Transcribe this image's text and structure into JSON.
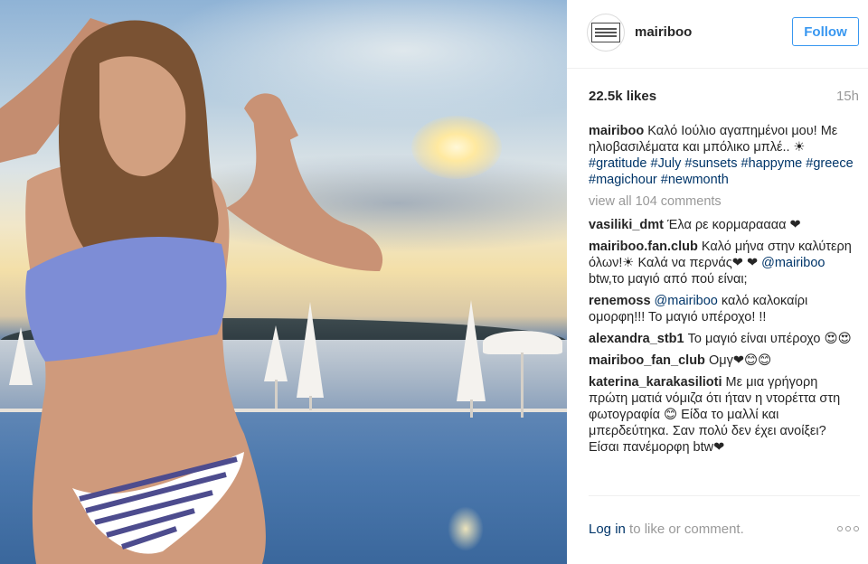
{
  "post": {
    "username": "mairiboo",
    "follow_label": "Follow",
    "likes": "22.5k likes",
    "time": "15h",
    "caption_user": "mairiboo",
    "caption_text": "Καλό Ιούλιο αγαπημένοι μου! Με ηλιοβασιλέματα και μπόλικο μπλέ.. ☀ ",
    "caption_tags": [
      "#gratitude",
      "#July",
      "#sunsets",
      "#happyme",
      "#greece",
      "#magichour",
      "#newmonth"
    ],
    "view_all": "view all 104 comments"
  },
  "comments": [
    {
      "user": "vasiliki_dmt",
      "text": "Έλα ρε κορμαραααα ❤"
    },
    {
      "user": "mairiboo.fan.club",
      "text": "Καλό μήνα στην καλύτερη όλων!☀ Καλά να περνάς❤ ❤ ",
      "mention": "@mairiboo",
      "text2": " btw,το μαγιό από πού είναι; "
    },
    {
      "user": "renemoss",
      "mention": "@mairiboo",
      "text": " καλό καλοκαίρι ομορφη!!! Το μαγιό υπέροχο! !!"
    },
    {
      "user": "alexandra_stb1",
      "text": "Το μαγιό είναι υπέροχο 😍😍"
    },
    {
      "user": "mairiboo_fan_club",
      "text": "Ομγ❤😊😊"
    },
    {
      "user": "katerina_karakasilioti",
      "text": "Με μια γρήγορη πρώτη ματιά νόμιζα ότι ήταν η ντορέττα στη φωτογραφία 😊 Είδα το μαλλί και μπερδεύτηκα. Σαν πολύ δεν έχει ανοίξει? Είσαι πανέμορφη btw❤"
    }
  ],
  "footer": {
    "login_link": "Log in",
    "login_text": " to like or comment."
  },
  "icons": {
    "more": "ellipsis-icon",
    "avatar": "profile-avatar"
  },
  "colors": {
    "follow_blue": "#3897f0",
    "link_blue": "#003569",
    "muted": "#999999"
  }
}
